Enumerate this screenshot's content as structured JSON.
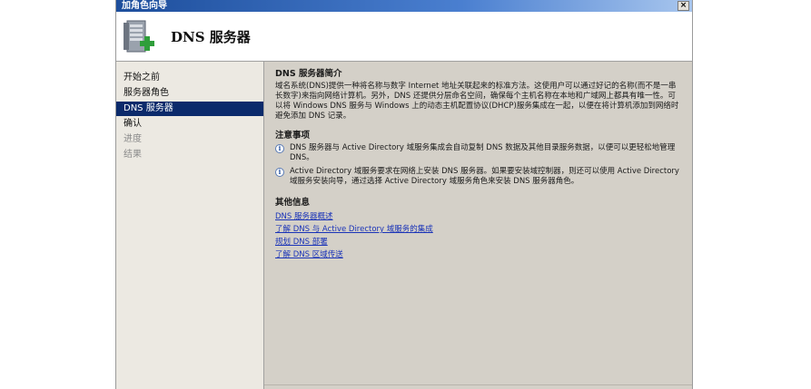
{
  "window": {
    "title": "加角色向导",
    "close_glyph": "×"
  },
  "header": {
    "title": "DNS 服务器",
    "icon": "server-add-icon"
  },
  "nav": {
    "items": [
      {
        "label": "开始之前",
        "state": "normal"
      },
      {
        "label": "服务器角色",
        "state": "normal"
      },
      {
        "label": "DNS 服务器",
        "state": "selected"
      },
      {
        "label": "确认",
        "state": "normal"
      },
      {
        "label": "进度",
        "state": "disabled"
      },
      {
        "label": "结果",
        "state": "disabled"
      }
    ]
  },
  "content": {
    "intro_title": "DNS 服务器简介",
    "intro_text": "域名系统(DNS)提供一种将名称与数字 Internet 地址关联起来的标准方法。这使用户可以通过好记的名称(而不是一串长数字)来指向网络计算机。另外，DNS 还提供分层命名空间，确保每个主机名称在本地和广域网上都具有唯一性。可以将 Windows DNS 服务与 Windows 上的动态主机配置协议(DHCP)服务集成在一起，以便在将计算机添加到网络时避免添加 DNS 记录。",
    "notes_title": "注意事项",
    "notes": [
      "DNS 服务器与 Active Directory 域服务集成会自动复制 DNS 数据及其他目录服务数据，以便可以更轻松地管理 DNS。",
      "Active Directory 域服务要求在网络上安装 DNS 服务器。如果要安装域控制器，则还可以使用 Active Directory 域服务安装向导，通过选择 Active Directory 域服务角色来安装 DNS 服务器角色。"
    ],
    "more_title": "其他信息",
    "links": [
      "DNS 服务器概述",
      "了解 DNS 与 Active Directory 域服务的集成",
      "规划 DNS 部署",
      "了解 DNS 区域传送"
    ]
  }
}
